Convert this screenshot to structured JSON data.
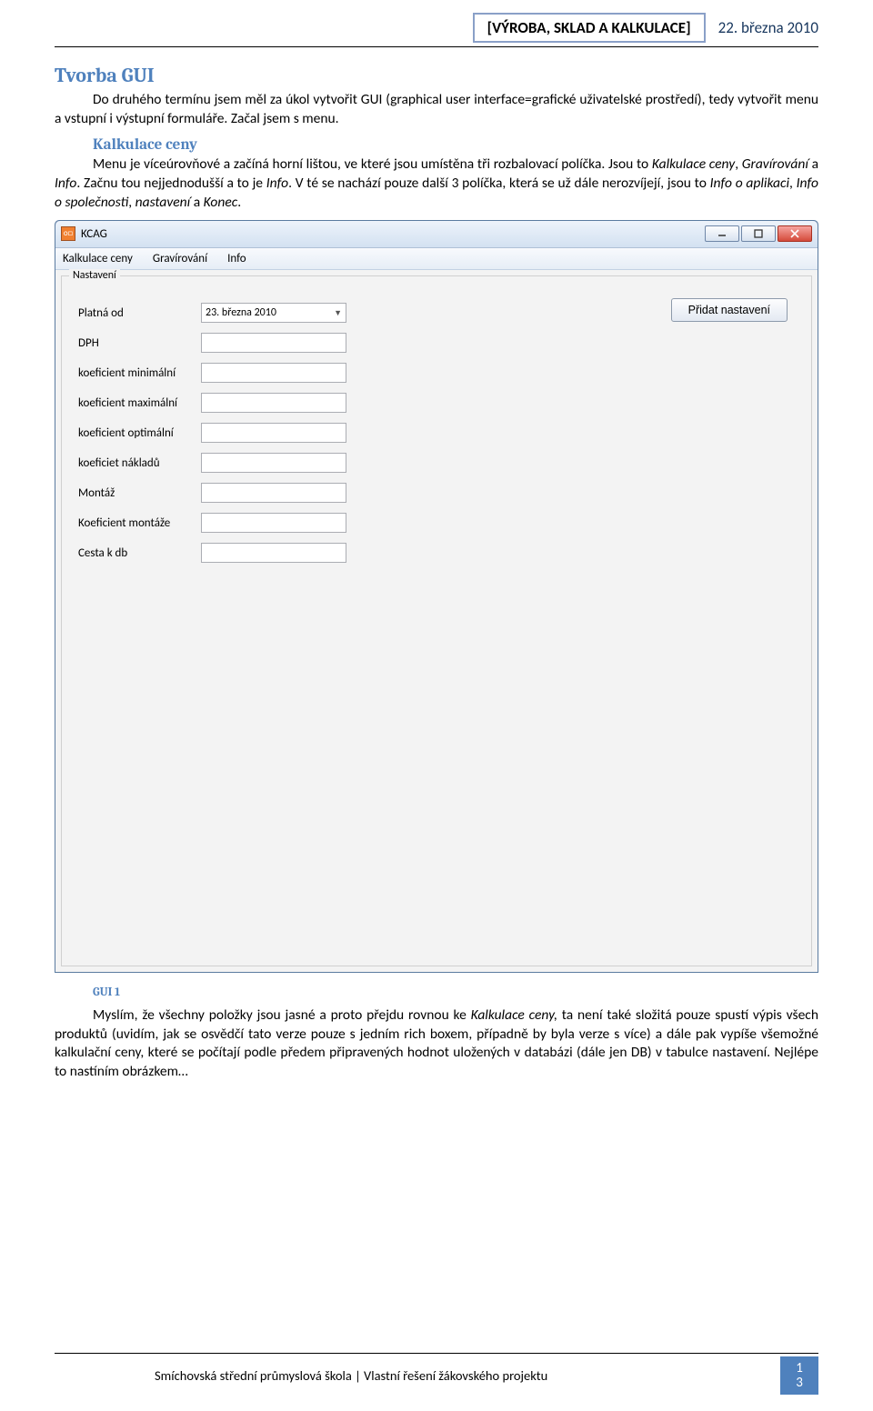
{
  "header": {
    "title_box": "[VÝROBA, SKLAD A KALKULACE]",
    "date": "22. března 2010"
  },
  "h2_main": "Tvorba GUI",
  "para1": "Do druhého termínu jsem měl za úkol vytvořit GUI (graphical user interface=grafické uživatelské prostředí), tedy vytvořit menu a vstupní i výstupní formuláře.  Začal jsem s menu.",
  "h3_sub": "Kalkulace ceny",
  "para2a": "Menu je víceúrovňové a začíná horní lištou, ve které jsou umístěna tři rozbalovací políčka. Jsou to ",
  "para2_i1": "Kalkulace ceny",
  "para2b": ", ",
  "para2_i2": "Gravírování",
  "para2c": " a ",
  "para2_i3": "Info",
  "para2d": ". Začnu tou nejjednodušší a to je ",
  "para2_i4": "Info",
  "para2e": ". V té se nachází pouze další 3 políčka, která se už dále nerozvíjejí, jsou to ",
  "para2_i5": "Info o aplikaci",
  "para2f": ", ",
  "para2_i6": "Info o společnosti",
  "para2g": ", ",
  "para2_i7": "nastavení",
  "para2h": " a ",
  "para2_i8": "Konec",
  "para2i": ".",
  "gui": {
    "title": "KCAG",
    "icon_text": "o□",
    "menu": {
      "m1": "Kalkulace ceny",
      "m2": "Gravírování",
      "m3": "Info"
    },
    "panel_title": "Nastavení",
    "add_button": "Přidat nastavení",
    "date_value": "23.  března  2010",
    "labels": {
      "l1": "Platná od",
      "l2": "DPH",
      "l3": "koeficient minimální",
      "l4": "koeficient maximální",
      "l5": "koeficient optimální",
      "l6": "koeficiet nákladů",
      "l7": "Montáž",
      "l8": "Koeficient montáže",
      "l9": "Cesta k db"
    }
  },
  "caption": "GUI 1",
  "para3a": "Myslím, že všechny položky jsou jasné a proto přejdu rovnou ke ",
  "para3_i1": "Kalkulace ceny, ",
  "para3b": "ta není také složitá pouze spustí výpis všech produktů (uvidím, jak se osvědčí tato verze pouze s jedním rich boxem, případně by byla verze s více) a dále pak vypíše všemožné kalkulační ceny, které se počítají podle předem připravených hodnot uložených v databázi (dále jen DB) v tabulce nastavení. Nejlépe to nastíním obrázkem…",
  "footer": {
    "text": "Smíchovská střední průmyslová škola | Vlastní řešení žákovského projektu",
    "page1": "1",
    "page2": "3"
  }
}
